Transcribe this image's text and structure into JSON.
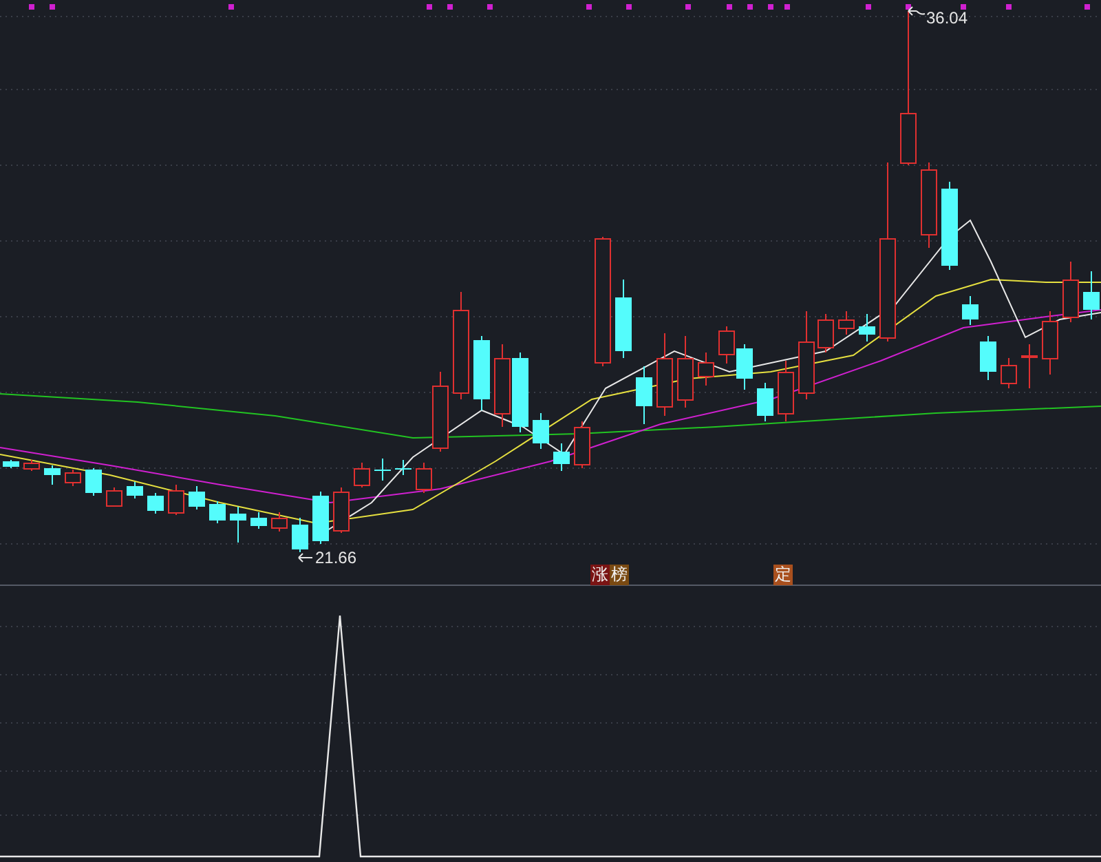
{
  "price_chart": {
    "high_label": "36.04",
    "low_label": "21.66",
    "markers": [
      {
        "text": "涨",
        "color": "#7a1414"
      },
      {
        "text": "榜",
        "color": "#7a4a12"
      },
      {
        "text": "定",
        "color": "#a9501e"
      }
    ]
  }
}
